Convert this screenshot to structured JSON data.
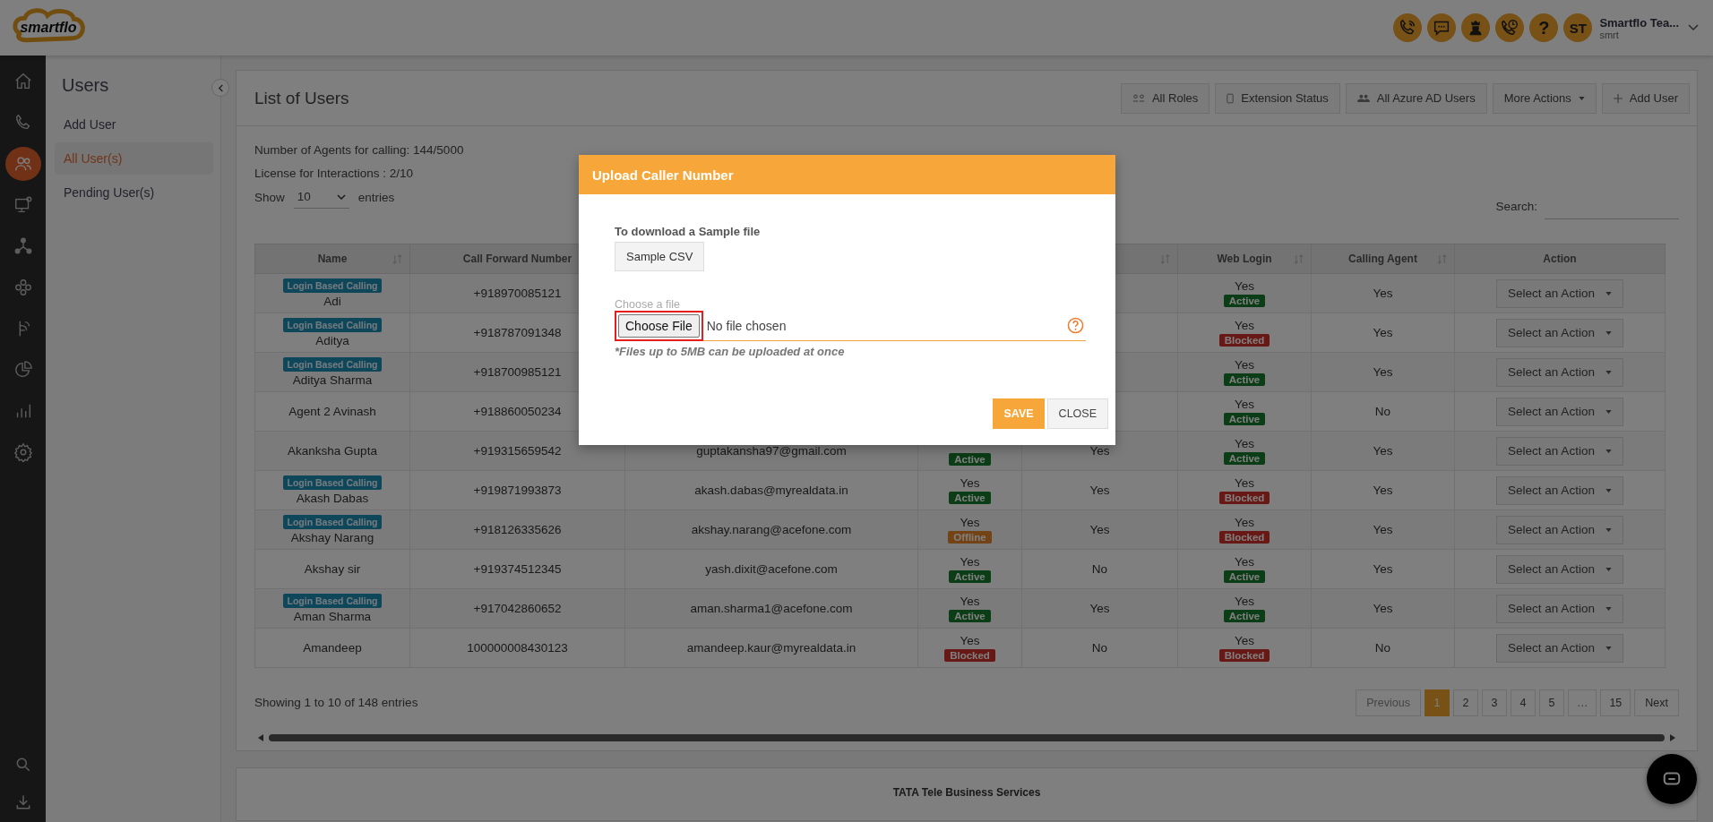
{
  "header": {
    "logo": "smartflo",
    "actions": [
      {
        "kind": "phone"
      },
      {
        "kind": "chat"
      },
      {
        "kind": "agent"
      },
      {
        "kind": "phone-clock"
      },
      {
        "kind": "help",
        "label": "?"
      }
    ],
    "user": {
      "initials": "ST",
      "name": "Smartflo Tea...",
      "org": "smrt"
    }
  },
  "rail": {
    "items": [
      {
        "kind": "home",
        "selected": false
      },
      {
        "kind": "phone",
        "selected": false
      },
      {
        "kind": "users",
        "selected": true
      },
      {
        "kind": "monitor",
        "selected": false
      },
      {
        "kind": "nodes",
        "selected": false
      },
      {
        "kind": "flower",
        "selected": false
      },
      {
        "kind": "hand-phone",
        "selected": false
      },
      {
        "kind": "pie",
        "selected": false
      },
      {
        "kind": "bars",
        "selected": false
      },
      {
        "kind": "gear",
        "selected": false
      }
    ],
    "bottom": [
      {
        "kind": "search"
      },
      {
        "kind": "download"
      }
    ]
  },
  "sidebar": {
    "title": "Users",
    "items": [
      {
        "label": "Add User",
        "selected": false
      },
      {
        "label": "All User(s)",
        "selected": true
      },
      {
        "label": "Pending User(s)",
        "selected": false
      }
    ]
  },
  "card": {
    "title": "List of Users",
    "toolbar": [
      {
        "label": "All Roles",
        "kind": "roles"
      },
      {
        "label": "Extension Status",
        "kind": "mobile"
      },
      {
        "label": "All Azure AD Users",
        "kind": "people"
      },
      {
        "label": "More Actions",
        "kind": "dropdown"
      },
      {
        "label": "Add User",
        "kind": "add"
      }
    ],
    "info": [
      "Number of Agents for calling: 144/5000",
      "License for Interactions : 2/10"
    ],
    "show_label": "Show",
    "page_length": "10",
    "entries_label": "entries",
    "search_label": "Search:"
  },
  "table": {
    "columns": [
      {
        "label": "Name",
        "sortable": true
      },
      {
        "label": "Call Forward Number"
      },
      {},
      {},
      {
        "sortable": true
      },
      {
        "label": "Web Login",
        "sortable": true
      },
      {
        "label": "Calling Agent",
        "sortable": true
      },
      {
        "label": "Action",
        "sortable": false
      }
    ],
    "rows": [
      {
        "tag": "Login Based Calling",
        "name": "Adi",
        "number": "+918970085121",
        "web_login": "Yes",
        "web_badge": {
          "label": "Active",
          "kind": "active"
        },
        "calling_agent": "Yes",
        "action": "Select an Action"
      },
      {
        "tag": "Login Based Calling",
        "name": "Aditya",
        "number": "+918787091348",
        "web_login": "Yes",
        "web_badge": {
          "label": "Blocked",
          "kind": "blocked"
        },
        "calling_agent": "Yes",
        "action": "Select an Action"
      },
      {
        "tag": "Login Based Calling",
        "name": "Aditya Sharma",
        "number": "+918700985121",
        "web_login": "Yes",
        "web_badge": {
          "label": "Active",
          "kind": "active"
        },
        "calling_agent": "Yes",
        "action": "Select an Action"
      },
      {
        "name": "Agent 2 Avinash",
        "number": "+918860050234",
        "web_login": "Yes",
        "web_badge": {
          "label": "Active",
          "kind": "active"
        },
        "calling_agent": "No",
        "action": "Select an Action"
      },
      {
        "name": "Akanksha Gupta",
        "number": "+919315659542",
        "email": "guptakansha97@gmail.com",
        "column_4_badge": {
          "label": "Active",
          "kind": "active"
        },
        "column_5": "Yes",
        "web_login": "Yes",
        "web_badge": {
          "label": "Active",
          "kind": "active"
        },
        "calling_agent": "Yes",
        "action": "Select an Action"
      },
      {
        "tag": "Login Based Calling",
        "name": "Akash Dabas",
        "number": "+919871993873",
        "email": "akash.dabas@myrealdata.in",
        "column_4": "Yes",
        "column_4_badge": {
          "label": "Active",
          "kind": "active"
        },
        "column_5": "Yes",
        "web_login": "Yes",
        "web_badge": {
          "label": "Blocked",
          "kind": "blocked"
        },
        "calling_agent": "Yes",
        "action": "Select an Action"
      },
      {
        "tag": "Login Based Calling",
        "name": "Akshay Narang",
        "number": "+918126335626",
        "email": "akshay.narang@acefone.com",
        "column_4": "Yes",
        "column_4_badge": {
          "label": "Offline",
          "kind": "offline"
        },
        "column_5": "Yes",
        "web_login": "Yes",
        "web_badge": {
          "label": "Blocked",
          "kind": "blocked"
        },
        "calling_agent": "Yes",
        "action": "Select an Action"
      },
      {
        "name": "Akshay sir",
        "number": "+919374512345",
        "email": "yash.dixit@acefone.com",
        "column_4": "Yes",
        "column_4_badge": {
          "label": "Active",
          "kind": "active"
        },
        "column_5": "No",
        "web_login": "Yes",
        "web_badge": {
          "label": "Active",
          "kind": "active"
        },
        "calling_agent": "Yes",
        "action": "Select an Action"
      },
      {
        "tag": "Login Based Calling",
        "name": "Aman Sharma",
        "number": "+917042860652",
        "email": "aman.sharma1@acefone.com",
        "column_4": "Yes",
        "column_4_badge": {
          "label": "Active",
          "kind": "active"
        },
        "column_5": "Yes",
        "web_login": "Yes",
        "web_badge": {
          "label": "Active",
          "kind": "active"
        },
        "calling_agent": "Yes",
        "action": "Select an Action"
      },
      {
        "name": "Amandeep",
        "number": "100000008430123",
        "email": "amandeep.kaur@myrealdata.in",
        "column_4": "Yes",
        "column_4_badge": {
          "label": "Blocked",
          "kind": "blocked"
        },
        "column_5": "No",
        "web_login": "Yes",
        "web_badge": {
          "label": "Blocked",
          "kind": "blocked"
        },
        "calling_agent": "No",
        "action": "Select an Action"
      }
    ]
  },
  "footer_info": "Showing 1 to 10 of 148 entries",
  "pagination": [
    {
      "label": "Previous",
      "kind": "prev",
      "disabled": true,
      "selected": false
    },
    {
      "label": "1",
      "kind": "page",
      "selected": true
    },
    {
      "label": "2",
      "kind": "page",
      "selected": false
    },
    {
      "label": "3",
      "kind": "page",
      "selected": false
    },
    {
      "label": "4",
      "kind": "page",
      "selected": false
    },
    {
      "label": "5",
      "kind": "page",
      "selected": false
    },
    {
      "label": "…",
      "kind": "ellipsis",
      "selected": false
    },
    {
      "label": "15",
      "kind": "page",
      "selected": false
    },
    {
      "label": "Next",
      "kind": "next",
      "disabled": false,
      "selected": false
    }
  ],
  "footer": "TATA Tele Business Services",
  "modal": {
    "title": "Upload Caller Number",
    "sample_label": "To download a Sample file",
    "sample_button": "Sample CSV",
    "file_label": "Choose a file",
    "file_button": "Choose File",
    "file_button_highlighted": true,
    "file_status": "No file chosen",
    "note": "*Files up to 5MB can be uploaded at once",
    "save": "SAVE",
    "close": "CLOSE"
  }
}
